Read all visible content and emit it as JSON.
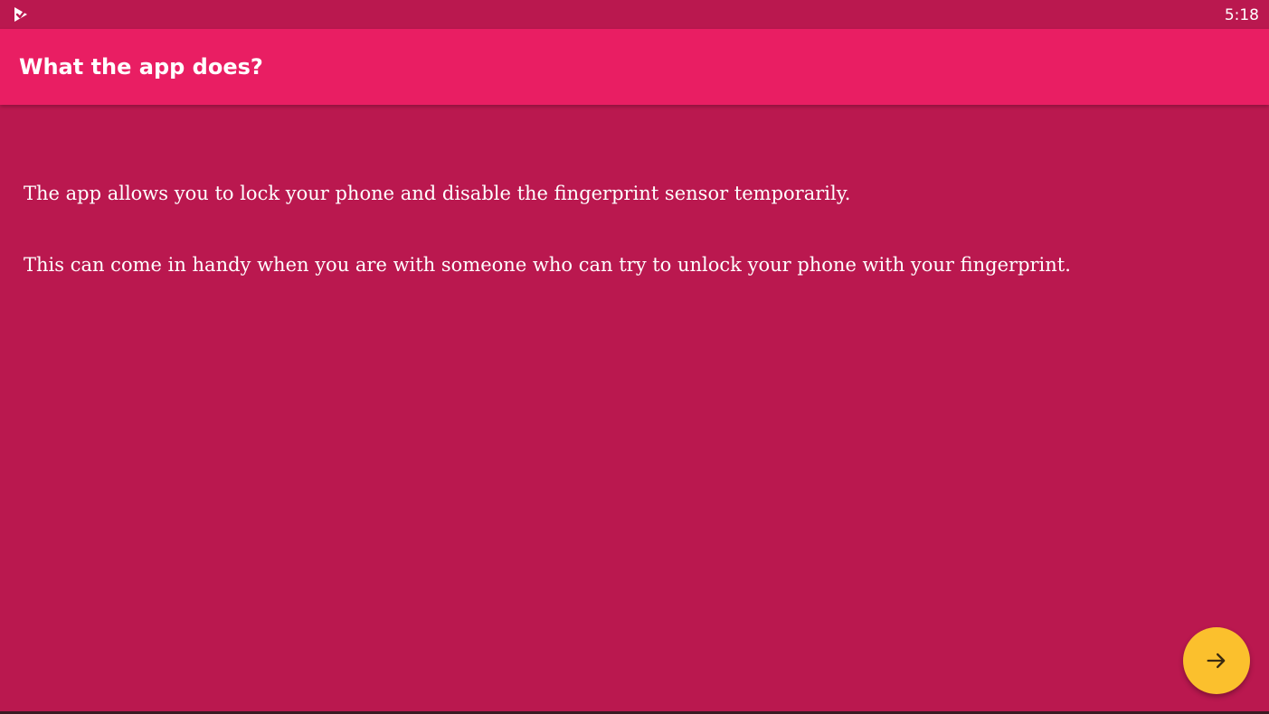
{
  "status_bar": {
    "time": "5:18",
    "app_icon": "play-check-icon"
  },
  "app_bar": {
    "title": "What the app does?"
  },
  "content": {
    "paragraphs": [
      "The app allows you to lock your phone and disable the fingerprint sensor temporarily.",
      "This can come in handy when you are with someone who can try to unlock your phone with your fingerprint."
    ]
  },
  "fab": {
    "icon": "arrow-right-icon"
  },
  "colors": {
    "background": "#ba184f",
    "app_bar": "#e91e63",
    "fab": "#fbc02d",
    "text": "#ffffff"
  }
}
